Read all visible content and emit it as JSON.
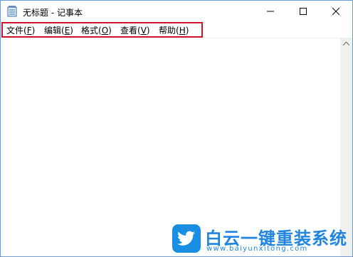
{
  "window": {
    "title": "无标题 - 记事本",
    "app_icon": "notepad-icon"
  },
  "controls": {
    "minimize_icon": "minimize-icon",
    "maximize_icon": "maximize-icon",
    "close_icon": "close-icon"
  },
  "menu": {
    "items": [
      {
        "text": "文件(",
        "key": "F",
        "end": ")"
      },
      {
        "text": "编辑(",
        "key": "E",
        "end": ")"
      },
      {
        "text": "格式(",
        "key": "O",
        "end": ")"
      },
      {
        "text": "查看(",
        "key": "V",
        "end": ")"
      },
      {
        "text": "帮助(",
        "key": "H",
        "end": ")"
      }
    ]
  },
  "editor": {
    "content": ""
  },
  "scrollbar": {
    "up_icon": "chevron-up-icon"
  },
  "watermark": {
    "title": "白云一键重装系统",
    "url": "www.baiyunxitong.com",
    "logo_icon": "twitter-bird-logo"
  },
  "colors": {
    "highlight_border": "#d3132e",
    "watermark_blue": "#2185e0"
  }
}
